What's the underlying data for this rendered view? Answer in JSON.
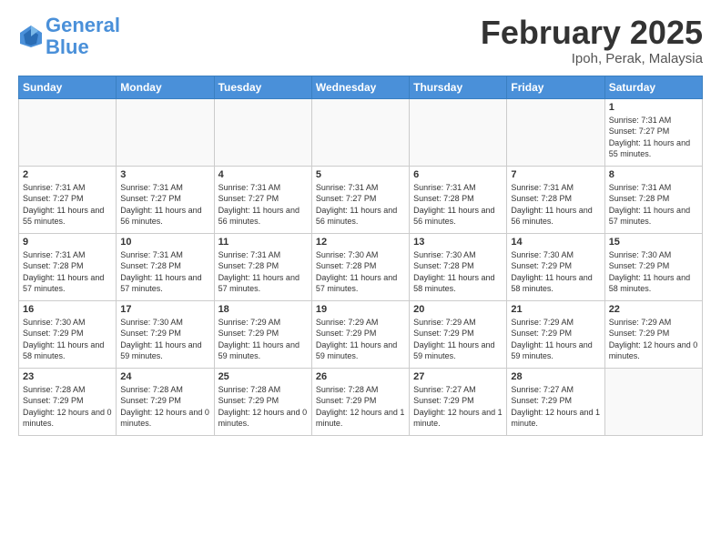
{
  "header": {
    "logo_text_general": "General",
    "logo_text_blue": "Blue",
    "month_title": "February 2025",
    "location": "Ipoh, Perak, Malaysia"
  },
  "days_of_week": [
    "Sunday",
    "Monday",
    "Tuesday",
    "Wednesday",
    "Thursday",
    "Friday",
    "Saturday"
  ],
  "weeks": [
    [
      {
        "day": "",
        "info": ""
      },
      {
        "day": "",
        "info": ""
      },
      {
        "day": "",
        "info": ""
      },
      {
        "day": "",
        "info": ""
      },
      {
        "day": "",
        "info": ""
      },
      {
        "day": "",
        "info": ""
      },
      {
        "day": "1",
        "info": "Sunrise: 7:31 AM\nSunset: 7:27 PM\nDaylight: 11 hours and 55 minutes."
      }
    ],
    [
      {
        "day": "2",
        "info": "Sunrise: 7:31 AM\nSunset: 7:27 PM\nDaylight: 11 hours and 55 minutes."
      },
      {
        "day": "3",
        "info": "Sunrise: 7:31 AM\nSunset: 7:27 PM\nDaylight: 11 hours and 56 minutes."
      },
      {
        "day": "4",
        "info": "Sunrise: 7:31 AM\nSunset: 7:27 PM\nDaylight: 11 hours and 56 minutes."
      },
      {
        "day": "5",
        "info": "Sunrise: 7:31 AM\nSunset: 7:27 PM\nDaylight: 11 hours and 56 minutes."
      },
      {
        "day": "6",
        "info": "Sunrise: 7:31 AM\nSunset: 7:28 PM\nDaylight: 11 hours and 56 minutes."
      },
      {
        "day": "7",
        "info": "Sunrise: 7:31 AM\nSunset: 7:28 PM\nDaylight: 11 hours and 56 minutes."
      },
      {
        "day": "8",
        "info": "Sunrise: 7:31 AM\nSunset: 7:28 PM\nDaylight: 11 hours and 57 minutes."
      }
    ],
    [
      {
        "day": "9",
        "info": "Sunrise: 7:31 AM\nSunset: 7:28 PM\nDaylight: 11 hours and 57 minutes."
      },
      {
        "day": "10",
        "info": "Sunrise: 7:31 AM\nSunset: 7:28 PM\nDaylight: 11 hours and 57 minutes."
      },
      {
        "day": "11",
        "info": "Sunrise: 7:31 AM\nSunset: 7:28 PM\nDaylight: 11 hours and 57 minutes."
      },
      {
        "day": "12",
        "info": "Sunrise: 7:30 AM\nSunset: 7:28 PM\nDaylight: 11 hours and 57 minutes."
      },
      {
        "day": "13",
        "info": "Sunrise: 7:30 AM\nSunset: 7:28 PM\nDaylight: 11 hours and 58 minutes."
      },
      {
        "day": "14",
        "info": "Sunrise: 7:30 AM\nSunset: 7:29 PM\nDaylight: 11 hours and 58 minutes."
      },
      {
        "day": "15",
        "info": "Sunrise: 7:30 AM\nSunset: 7:29 PM\nDaylight: 11 hours and 58 minutes."
      }
    ],
    [
      {
        "day": "16",
        "info": "Sunrise: 7:30 AM\nSunset: 7:29 PM\nDaylight: 11 hours and 58 minutes."
      },
      {
        "day": "17",
        "info": "Sunrise: 7:30 AM\nSunset: 7:29 PM\nDaylight: 11 hours and 59 minutes."
      },
      {
        "day": "18",
        "info": "Sunrise: 7:29 AM\nSunset: 7:29 PM\nDaylight: 11 hours and 59 minutes."
      },
      {
        "day": "19",
        "info": "Sunrise: 7:29 AM\nSunset: 7:29 PM\nDaylight: 11 hours and 59 minutes."
      },
      {
        "day": "20",
        "info": "Sunrise: 7:29 AM\nSunset: 7:29 PM\nDaylight: 11 hours and 59 minutes."
      },
      {
        "day": "21",
        "info": "Sunrise: 7:29 AM\nSunset: 7:29 PM\nDaylight: 11 hours and 59 minutes."
      },
      {
        "day": "22",
        "info": "Sunrise: 7:29 AM\nSunset: 7:29 PM\nDaylight: 12 hours and 0 minutes."
      }
    ],
    [
      {
        "day": "23",
        "info": "Sunrise: 7:28 AM\nSunset: 7:29 PM\nDaylight: 12 hours and 0 minutes."
      },
      {
        "day": "24",
        "info": "Sunrise: 7:28 AM\nSunset: 7:29 PM\nDaylight: 12 hours and 0 minutes."
      },
      {
        "day": "25",
        "info": "Sunrise: 7:28 AM\nSunset: 7:29 PM\nDaylight: 12 hours and 0 minutes."
      },
      {
        "day": "26",
        "info": "Sunrise: 7:28 AM\nSunset: 7:29 PM\nDaylight: 12 hours and 1 minute."
      },
      {
        "day": "27",
        "info": "Sunrise: 7:27 AM\nSunset: 7:29 PM\nDaylight: 12 hours and 1 minute."
      },
      {
        "day": "28",
        "info": "Sunrise: 7:27 AM\nSunset: 7:29 PM\nDaylight: 12 hours and 1 minute."
      },
      {
        "day": "",
        "info": ""
      }
    ]
  ]
}
